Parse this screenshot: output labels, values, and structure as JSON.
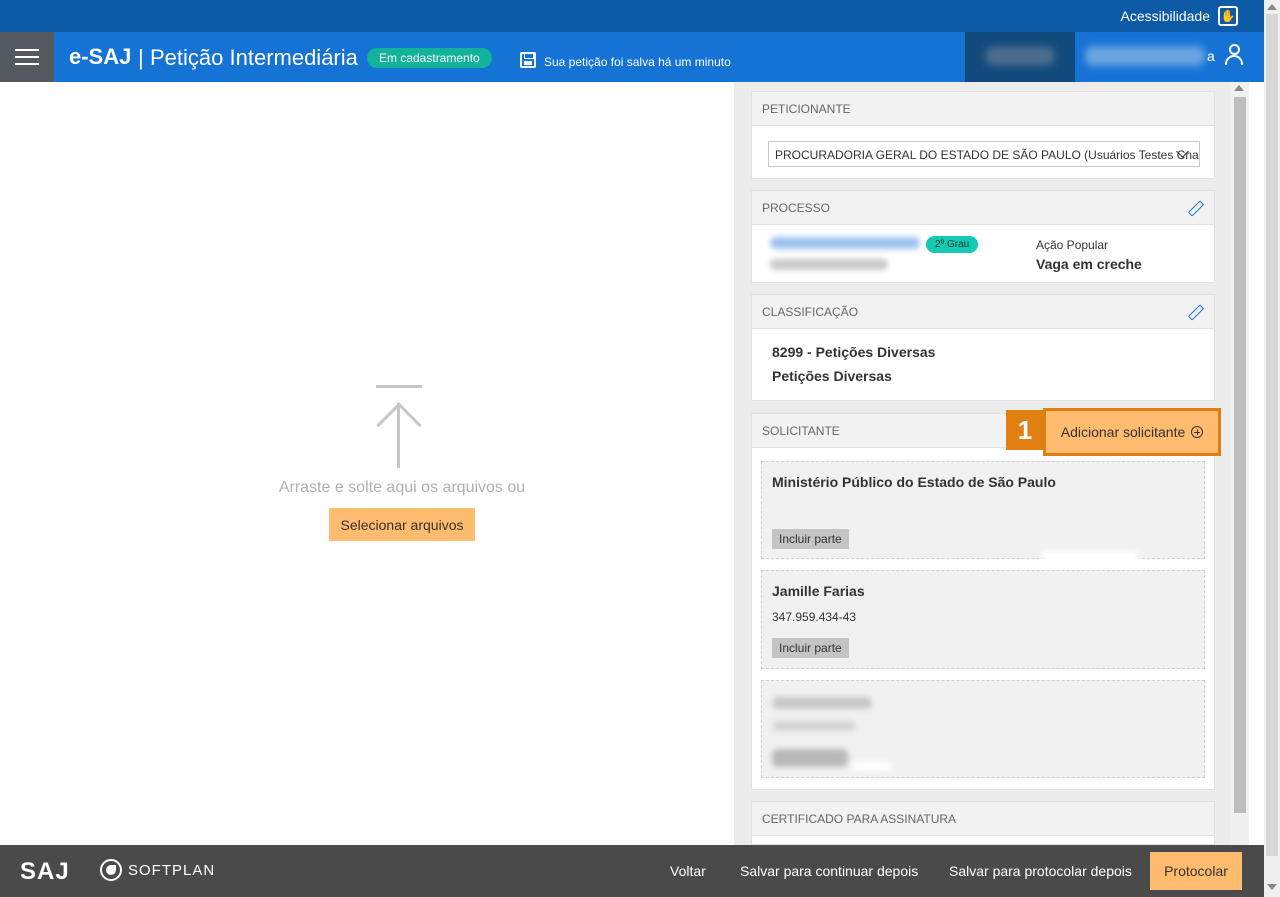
{
  "topbar": {
    "accessibility_label": "Acessibilidade"
  },
  "header": {
    "brand": "e-SAJ",
    "separator": "|",
    "title": "Petição Intermediária",
    "status": "Em cadastramento",
    "save_message": "Sua petição foi salva há um minuto",
    "user_suffix": "a"
  },
  "dropzone": {
    "instruction": "Arraste e solte aqui os arquivos ou",
    "select_button": "Selecionar arquivos"
  },
  "peticionante": {
    "heading": "PETICIONANTE",
    "selected": "PROCURADORIA GERAL DO ESTADO DE SÃO PAULO (Usuários Testes Cna - "
  },
  "processo": {
    "heading": "PROCESSO",
    "grau": "2º Grau",
    "type": "Ação Popular",
    "subject": "Vaga em creche"
  },
  "classificacao": {
    "heading": "CLASSIFICAÇÃO",
    "code_line": "8299 - Petições Diversas",
    "name_line": "Petições Diversas"
  },
  "solicitante": {
    "heading": "SOLICITANTE",
    "step_number": "1",
    "add_button": "Adicionar solicitante",
    "cards": [
      {
        "name": "Ministério Público do Estado de São Paulo",
        "doc": "",
        "include": "Incluir parte"
      },
      {
        "name": "Jamille Farias",
        "doc": "347.959.434-43",
        "include": "Incluir parte"
      }
    ]
  },
  "certificado": {
    "heading": "CERTIFICADO PARA ASSINATURA"
  },
  "footer": {
    "saj": "SAJ",
    "softplan": "SOFTPLAN",
    "voltar": "Voltar",
    "save_later": "Salvar para continuar depois",
    "save_protocol_later": "Salvar para protocolar depois",
    "protocolar": "Protocolar"
  },
  "colors": {
    "primary": "#1673d6",
    "topbar": "#0d5aa7",
    "accent_button": "#ffbc6f",
    "step_orange": "#e07f12",
    "status_green": "#12b39a"
  }
}
